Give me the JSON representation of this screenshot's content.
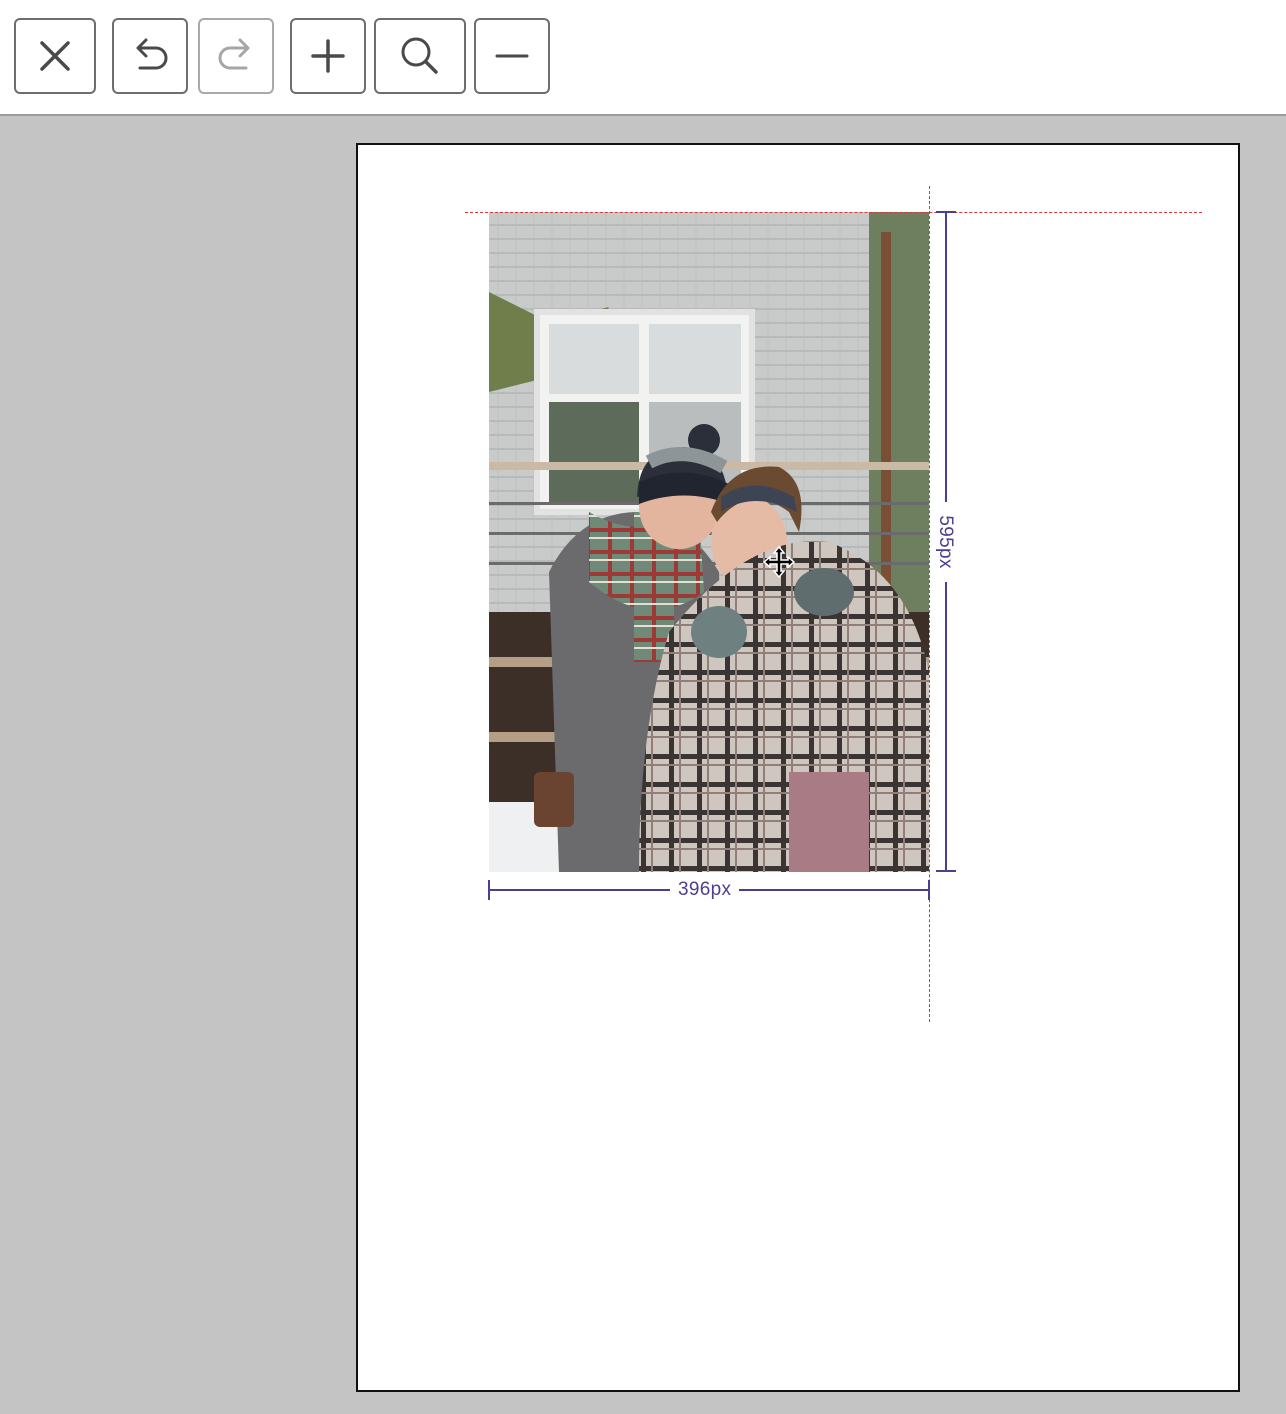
{
  "toolbar": {
    "buttons": [
      {
        "name": "close",
        "icon": "close-icon",
        "enabled": true
      },
      {
        "name": "undo",
        "icon": "undo-icon",
        "enabled": true
      },
      {
        "name": "redo",
        "icon": "redo-icon",
        "enabled": false
      },
      {
        "name": "zoom-in",
        "icon": "plus-icon",
        "enabled": true
      },
      {
        "name": "zoom",
        "icon": "search-icon",
        "enabled": true
      },
      {
        "name": "zoom-out",
        "icon": "minus-icon",
        "enabled": true
      }
    ]
  },
  "canvas": {
    "image": {
      "subject": "photo",
      "width_label": "396px",
      "height_label": "595px"
    }
  },
  "colors": {
    "guide": "#d9383a",
    "dimension": "#4b3f8f",
    "workspace": "#c4c4c4"
  }
}
